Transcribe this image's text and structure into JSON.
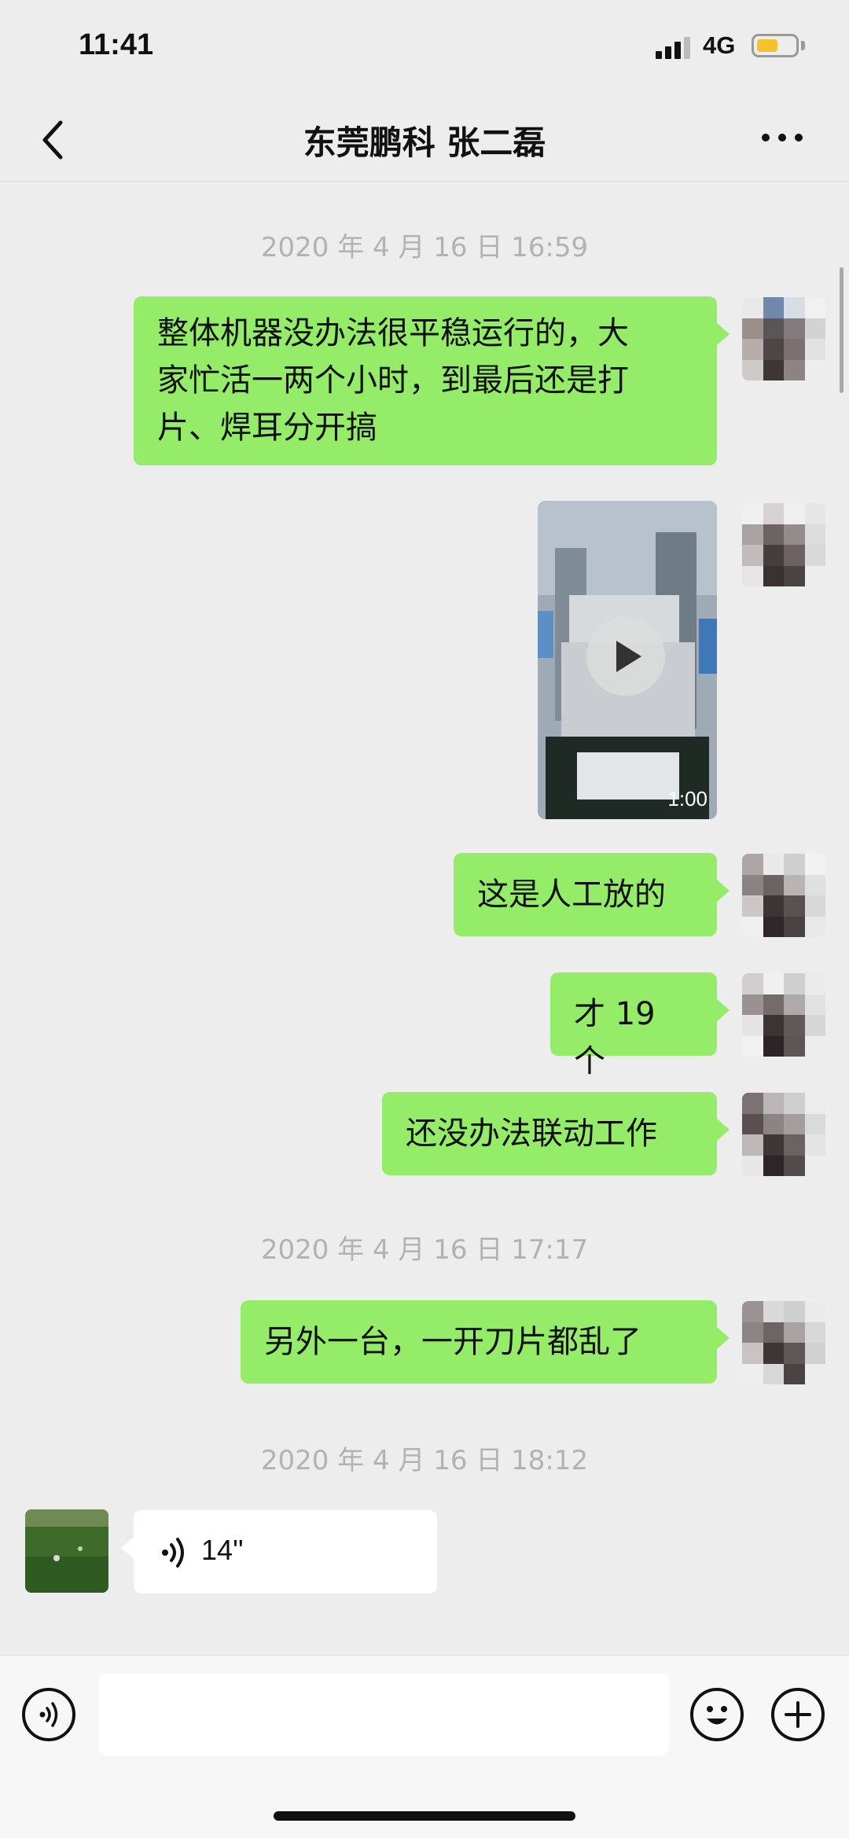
{
  "status_bar": {
    "time": "11:41",
    "network": "4G"
  },
  "nav": {
    "title": "东莞鹏科 张二磊"
  },
  "messages": {
    "ts1": "2020 年 4 月 16 日 16:59",
    "m1_lines": [
      "整体机器没办法很平稳运行的，大",
      "家忙活一两个小时，到最后还是打",
      "片、焊耳分开搞"
    ],
    "video_duration": "1:00",
    "m2": "这是人工放的",
    "m3": "才 19 个",
    "m4": "还没办法联动工作",
    "ts2": "2020 年 4 月 16 日 17:17",
    "m5": "另外一台，一开刀片都乱了",
    "ts3": "2020 年 4 月 16 日 18:12",
    "voice_duration": "14''"
  },
  "colors": {
    "outgoing_bubble": "#95ec69",
    "incoming_bubble": "#ffffff",
    "background": "#ededed"
  },
  "icons": [
    "back-icon",
    "more-icon",
    "play-icon",
    "voice-wave-icon",
    "voice-mode-icon",
    "emoji-icon",
    "plus-icon"
  ]
}
